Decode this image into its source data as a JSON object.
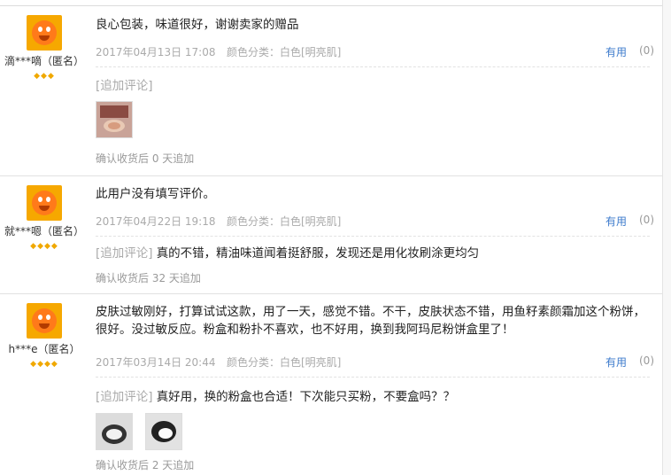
{
  "reviews": [
    {
      "user": "滴***嘀（匿名）",
      "stars": "◆◆◆",
      "text": "良心包装，味道很好，谢谢卖家的赠品",
      "date": "2017年04月13日 17:08",
      "color": "颜色分类：白色[明亮肌]",
      "useful_label": "有用",
      "useful_count": "(0)",
      "append_label": "[追加评论]",
      "append_text": "",
      "footer": "确认收货后 0 天追加"
    },
    {
      "user": "就***嗯（匿名）",
      "stars": "◆◆◆◆",
      "text": "此用户没有填写评价。",
      "date": "2017年04月22日 19:18",
      "color": "颜色分类：白色[明亮肌]",
      "useful_label": "有用",
      "useful_count": "(0)",
      "append_label": "[追加评论]",
      "append_text": "真的不错，精油味道闻着挺舒服，发现还是用化妆刷涂更均匀",
      "footer": "确认收货后 32 天追加"
    },
    {
      "user": "h***e（匿名）",
      "stars": "◆◆◆◆",
      "text": "皮肤过敏刚好，打算试试这款，用了一天，感觉不错。不干，皮肤状态不错，用鱼籽素颜霜加这个粉饼，很好。没过敏反应。粉盒和粉扑不喜欢，也不好用，换到我阿玛尼粉饼盒里了！",
      "date": "2017年03月14日 20:44",
      "color": "颜色分类：白色[明亮肌]",
      "useful_label": "有用",
      "useful_count": "(0)",
      "append_label": "[追加评论]",
      "append_text": "真好用，换的粉盒也合适！下次能只买粉，不要盒吗？？",
      "footer": "确认收货后 2 天追加"
    }
  ]
}
